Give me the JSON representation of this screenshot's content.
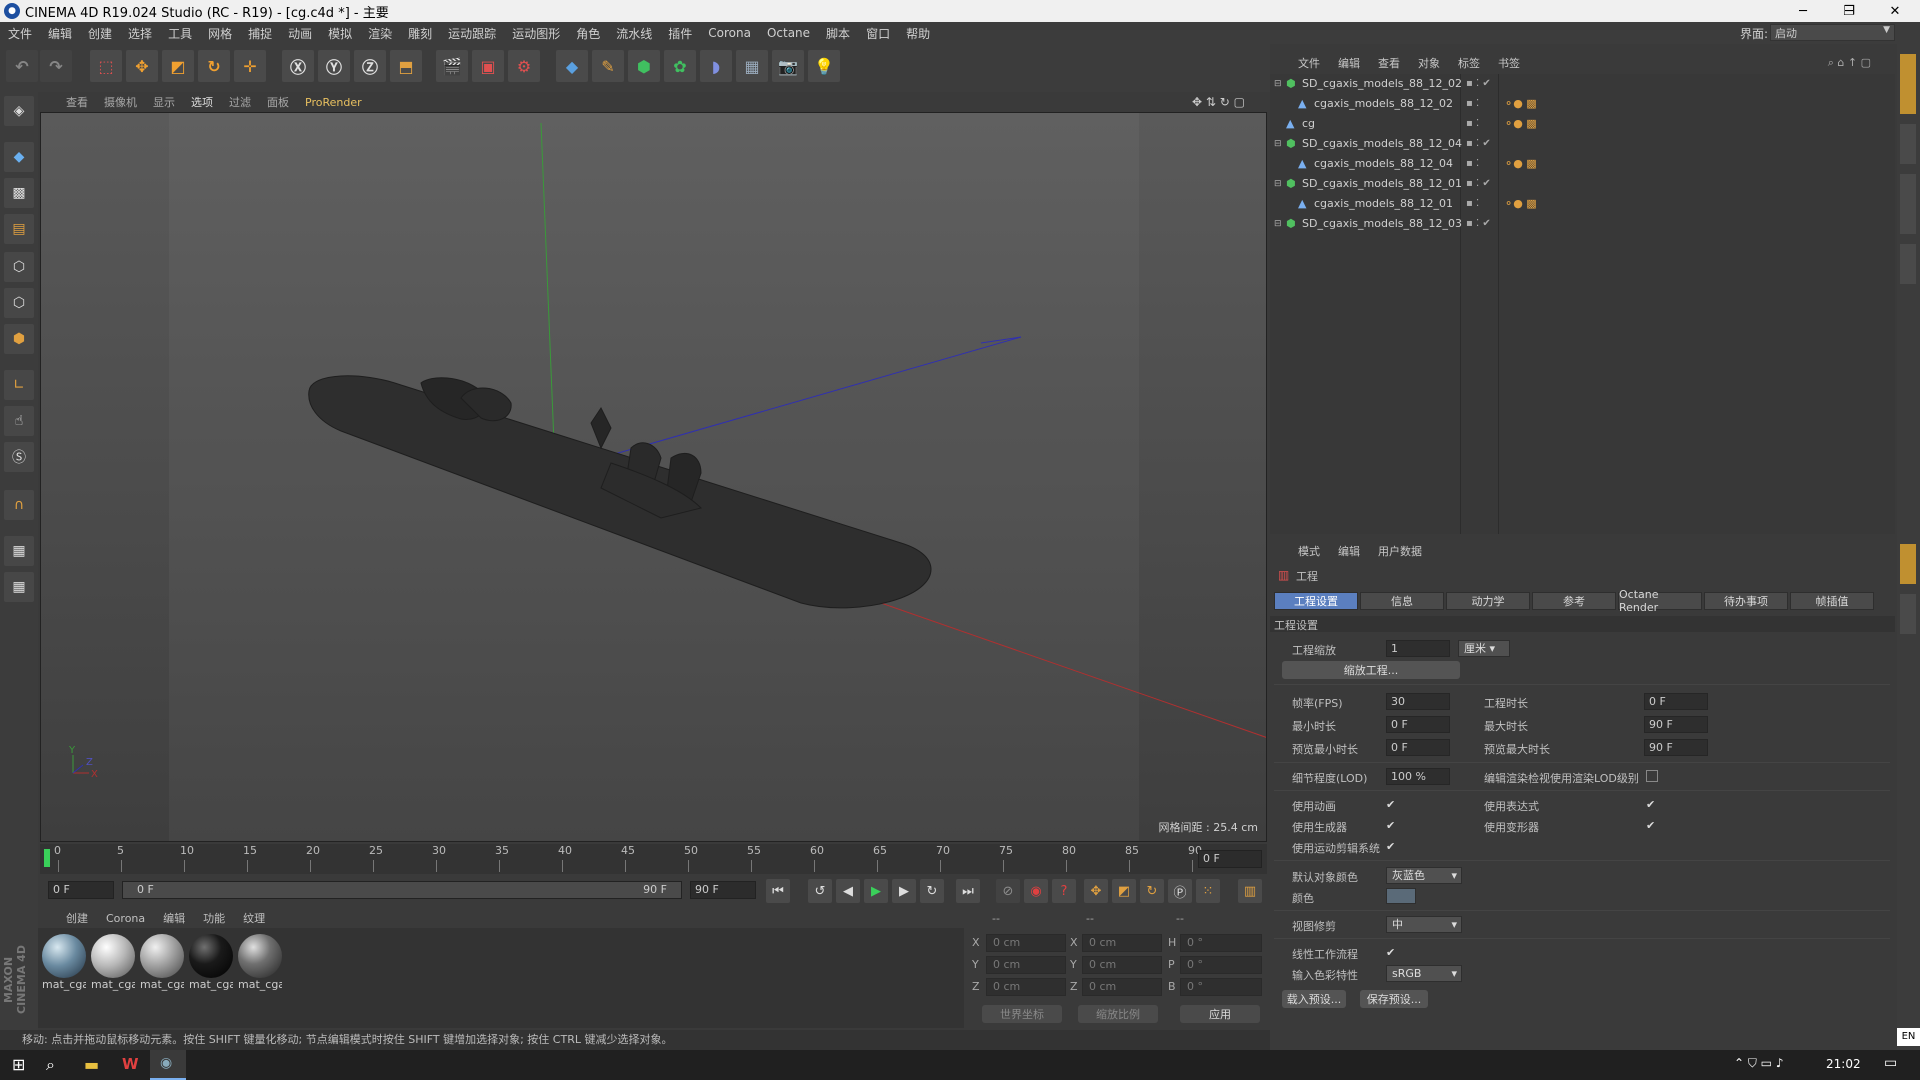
{
  "window": {
    "title": "CINEMA 4D R19.024 Studio (RC - R19) - [cg.c4d *] - 主要"
  },
  "menu": [
    "文件",
    "编辑",
    "创建",
    "选择",
    "工具",
    "网格",
    "捕捉",
    "动画",
    "模拟",
    "渲染",
    "雕刻",
    "运动跟踪",
    "运动图形",
    "角色",
    "流水线",
    "插件",
    "Corona",
    "Octane",
    "脚本",
    "窗口",
    "帮助"
  ],
  "layout": {
    "label": "界面:",
    "value": "启动"
  },
  "viewport": {
    "menu": [
      "查看",
      "摄像机",
      "显示",
      "选项",
      "过滤",
      "面板",
      "ProRender"
    ],
    "grid_spacing": "网格间距 : 25.4 cm"
  },
  "timeline": {
    "ticks": [
      "0",
      "5",
      "10",
      "15",
      "20",
      "25",
      "30",
      "35",
      "40",
      "45",
      "50",
      "55",
      "60",
      "65",
      "70",
      "75",
      "80",
      "85",
      "90"
    ],
    "current_frame": "0 F",
    "start_frame": "0 F",
    "range_start": "0 F",
    "range_end": "90 F",
    "end_frame": "90 F"
  },
  "materials": {
    "menu": [
      "创建",
      "Corona",
      "编辑",
      "功能",
      "纹理"
    ],
    "items": [
      {
        "label": "mat_cga"
      },
      {
        "label": "mat_cga"
      },
      {
        "label": "mat_cga"
      },
      {
        "label": "mat_cga"
      },
      {
        "label": "mat_cga"
      }
    ]
  },
  "coords": {
    "headers": [
      "--",
      "--",
      "--"
    ],
    "rows": [
      {
        "a": "X",
        "av": "0 cm",
        "b": "X",
        "bv": "0 cm",
        "c": "H",
        "cv": "0 °"
      },
      {
        "a": "Y",
        "av": "0 cm",
        "b": "Y",
        "bv": "0 cm",
        "c": "P",
        "cv": "0 °"
      },
      {
        "a": "Z",
        "av": "0 cm",
        "b": "Z",
        "bv": "0 cm",
        "c": "B",
        "cv": "0 °"
      }
    ],
    "world": "世界坐标",
    "scale": "缩放比例",
    "apply": "应用"
  },
  "status": "移动: 点击并拖动鼠标移动元素。按住 SHIFT 键量化移动; 节点编辑模式时按住 SHIFT 键增加选择对象; 按住 CTRL 键减少选择对象。",
  "objects": {
    "menu": [
      "文件",
      "编辑",
      "查看",
      "对象",
      "标签",
      "书签"
    ],
    "items": [
      {
        "name": "SD_cgaxis_models_88_12_02",
        "indent": 0
      },
      {
        "name": "cgaxis_models_88_12_02",
        "indent": 1
      },
      {
        "name": "cg",
        "indent": 0
      },
      {
        "name": "SD_cgaxis_models_88_12_04",
        "indent": 0
      },
      {
        "name": "cgaxis_models_88_12_04",
        "indent": 1
      },
      {
        "name": "SD_cgaxis_models_88_12_01",
        "indent": 0
      },
      {
        "name": "cgaxis_models_88_12_01",
        "indent": 1
      },
      {
        "name": "SD_cgaxis_models_88_12_03",
        "indent": 0
      }
    ]
  },
  "attributes": {
    "menu": [
      "模式",
      "编辑",
      "用户数据"
    ],
    "header": "工程",
    "tabs": [
      "工程设置",
      "信息",
      "动力学",
      "参考",
      "Octane Render",
      "待办事项",
      "帧插值"
    ],
    "section": "工程设置",
    "project_scale_label": "工程缩放",
    "project_scale": "1",
    "project_scale_unit": "厘米",
    "scale_project_btn": "缩放工程...",
    "fps_label": "帧率(FPS)",
    "fps": "30",
    "proj_time_label": "工程时长",
    "proj_time": "0 F",
    "min_time_label": "最小时长",
    "min_time": "0 F",
    "max_time_label": "最大时长",
    "max_time": "90 F",
    "prev_min_label": "预览最小时长",
    "prev_min": "0 F",
    "prev_max_label": "预览最大时长",
    "prev_max": "90 F",
    "lod_label": "细节程度(LOD)",
    "lod": "100 %",
    "lod_render_label": "编辑渲染检视使用渲染LOD级别",
    "use_anim": "使用动画",
    "use_expr": "使用表达式",
    "use_gen": "使用生成器",
    "use_deform": "使用变形器",
    "use_motion": "使用运动剪辑系统",
    "default_color_label": "默认对象颜色",
    "default_color": "灰蓝色",
    "color_label": "颜色",
    "view_clip_label": "视图修剪",
    "view_clip": "中",
    "linear_label": "线性工作流程",
    "input_color_label": "输入色彩特性",
    "input_color": "sRGB",
    "load_preset": "载入预设...",
    "save_preset": "保存预设..."
  },
  "taskbar": {
    "time": "21:02",
    "lang": "EN"
  }
}
